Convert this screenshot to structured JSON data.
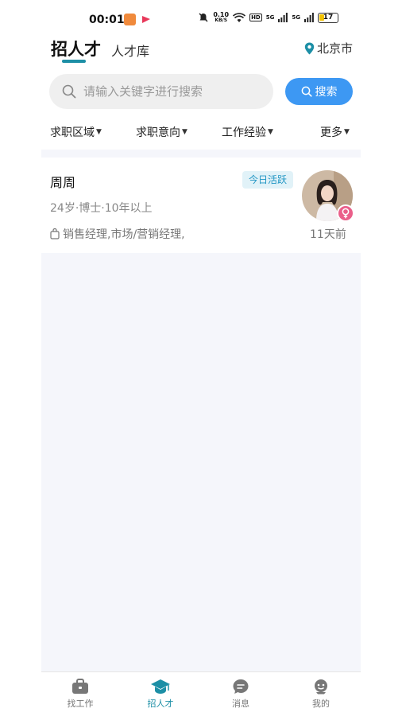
{
  "status_bar": {
    "time": "00:01",
    "net_speed_top": "0.10",
    "net_speed_unit": "KB/S",
    "hd_label": "HD",
    "signal1_label": "5G",
    "signal2_label": "5G",
    "battery_level": "17"
  },
  "header": {
    "tab_active": "招人才",
    "tab_inactive": "人才库",
    "location": "北京市"
  },
  "search": {
    "placeholder": "请输入关键字进行搜索",
    "button_label": "搜索"
  },
  "filters": [
    {
      "label": "求职区域"
    },
    {
      "label": "求职意向"
    },
    {
      "label": "工作经验"
    },
    {
      "label": "更多"
    }
  ],
  "candidates": [
    {
      "name": "周周",
      "badge": "今日活跃",
      "meta": "24岁·博士·10年以上",
      "positions": "销售经理,市场/营销经理,",
      "time": "11天前",
      "gender": "female"
    }
  ],
  "bottom_nav": [
    {
      "label": "找工作",
      "icon": "briefcase-icon",
      "active": false
    },
    {
      "label": "招人才",
      "icon": "graduation-cap-icon",
      "active": true
    },
    {
      "label": "消息",
      "icon": "chat-bubble-icon",
      "active": false
    },
    {
      "label": "我的",
      "icon": "profile-icon",
      "active": false
    }
  ],
  "colors": {
    "accent": "#1d8fa6",
    "search_button": "#3d98f3",
    "badge_bg": "#e1f2f8",
    "badge_text": "#2196c4",
    "female": "#ea5f8a",
    "list_bg": "#f5f6fb"
  }
}
